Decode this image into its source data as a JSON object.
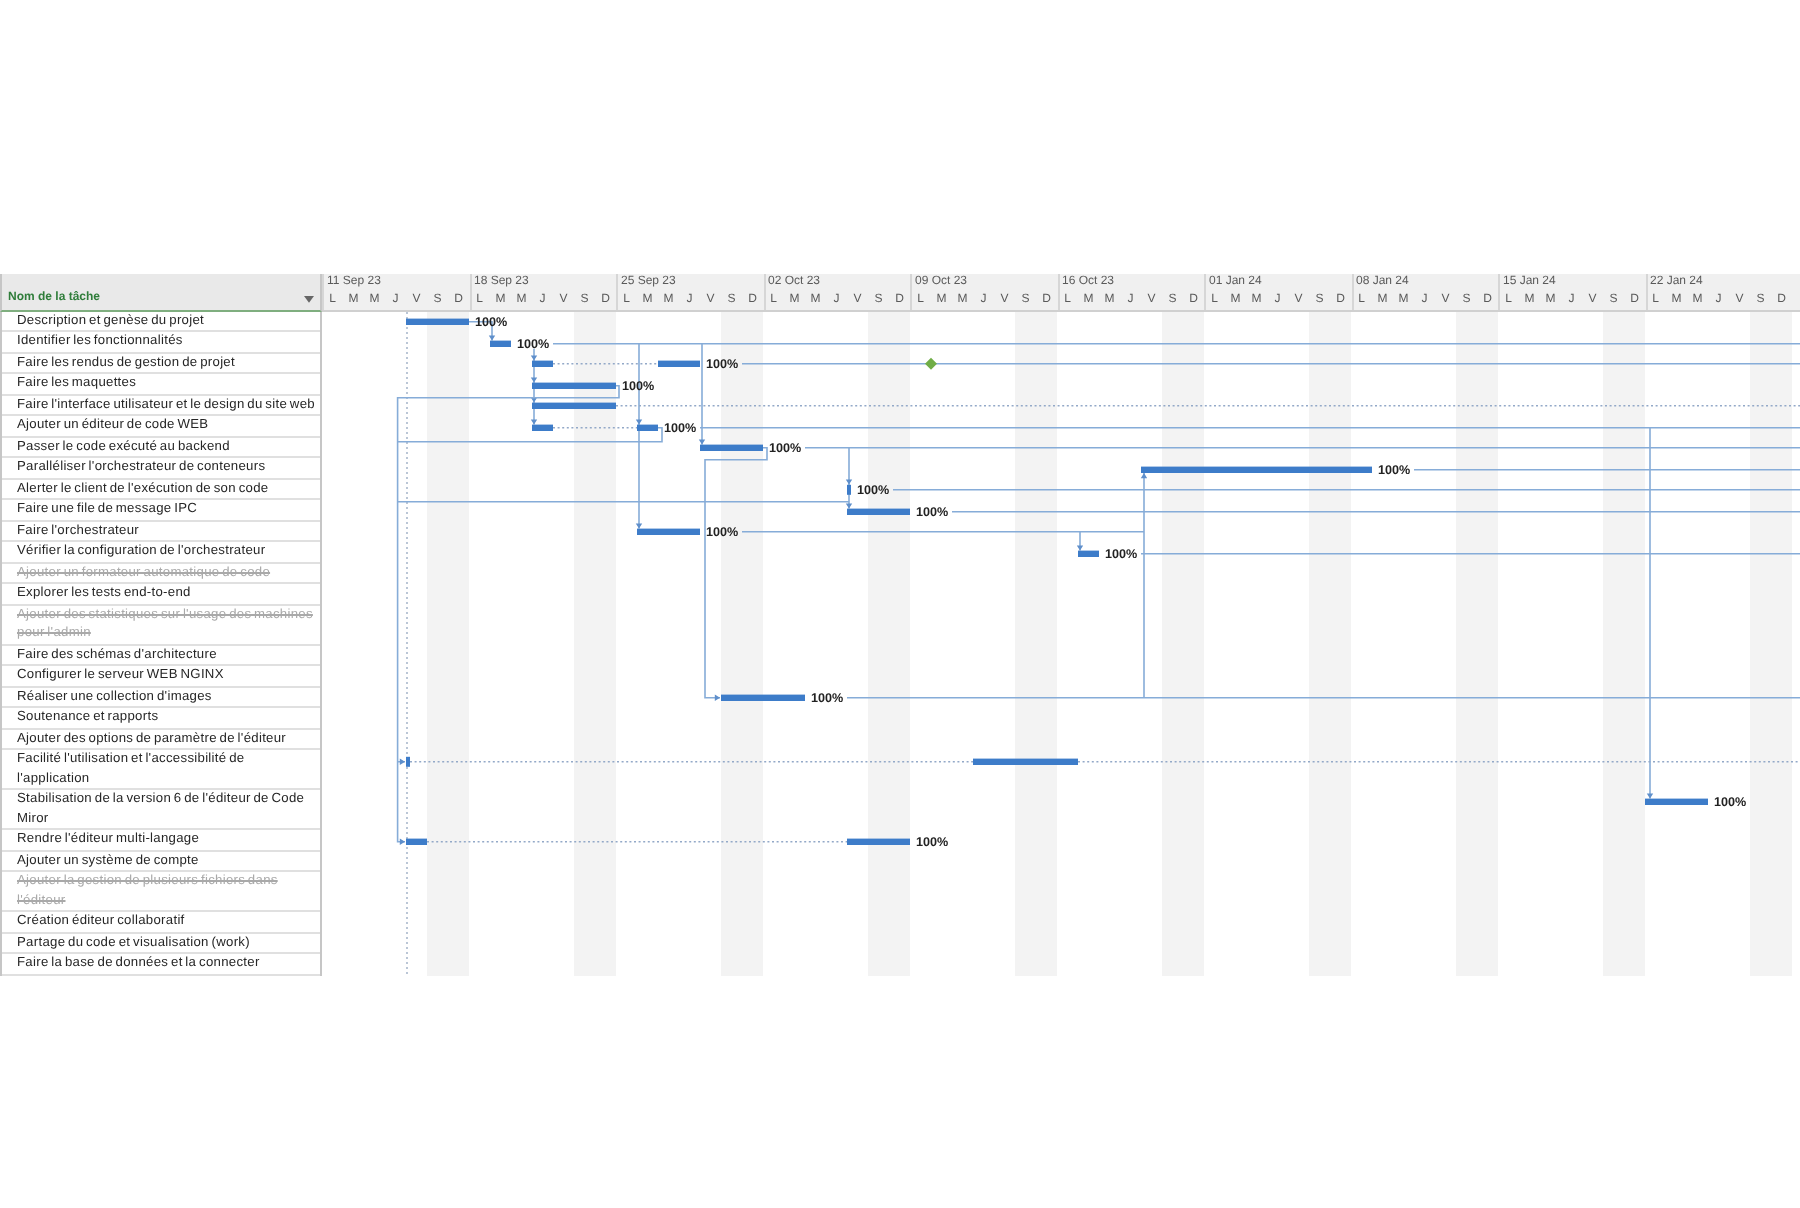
{
  "sheet": {
    "column_header": "Nom de la tâche"
  },
  "timeline": {
    "weeks": [
      {
        "label": "11 Sep 23",
        "days": [
          "L",
          "M",
          "M",
          "J",
          "V",
          "S",
          "D"
        ]
      },
      {
        "label": "18 Sep 23",
        "days": [
          "L",
          "M",
          "M",
          "J",
          "V",
          "S",
          "D"
        ]
      },
      {
        "label": "25 Sep 23",
        "days": [
          "L",
          "M",
          "M",
          "J",
          "V",
          "S",
          "D"
        ]
      },
      {
        "label": "02 Oct 23",
        "days": [
          "L",
          "M",
          "M",
          "J",
          "V",
          "S",
          "D"
        ]
      },
      {
        "label": "09 Oct 23",
        "days": [
          "L",
          "M",
          "M",
          "J",
          "V",
          "S",
          "D"
        ]
      },
      {
        "label": "16 Oct 23",
        "days": [
          "L",
          "M",
          "M",
          "J",
          "V",
          "S",
          "D"
        ]
      },
      {
        "label": "01 Jan 24",
        "days": [
          "L",
          "M",
          "M",
          "J",
          "V",
          "S",
          "D"
        ]
      },
      {
        "label": "08 Jan 24",
        "days": [
          "L",
          "M",
          "M",
          "J",
          "V",
          "S",
          "D"
        ]
      },
      {
        "label": "15 Jan 24",
        "days": [
          "L",
          "M",
          "M",
          "J",
          "V",
          "S",
          "D"
        ]
      },
      {
        "label": "22 Jan 24",
        "days": [
          "L",
          "M",
          "M",
          "J",
          "V",
          "S",
          "D"
        ]
      }
    ]
  },
  "tasks": [
    {
      "name": "Description et genèse du projet",
      "inactive": false,
      "progress": "100%"
    },
    {
      "name": "Identifier les fonctionnalités",
      "inactive": false,
      "progress": "100%"
    },
    {
      "name": "Faire les rendus de gestion de projet",
      "inactive": false,
      "progress": "100%"
    },
    {
      "name": "Faire les maquettes",
      "inactive": false,
      "progress": "100%"
    },
    {
      "name": "Faire l'interface utilisateur et le design du site web",
      "inactive": false
    },
    {
      "name": "Ajouter un éditeur de code WEB",
      "inactive": false,
      "progress": "100%"
    },
    {
      "name": "Passer le code exécuté au backend",
      "inactive": false,
      "progress": "100%"
    },
    {
      "name": "Paralléliser l'orchestrateur de conteneurs",
      "inactive": false,
      "progress": "100%"
    },
    {
      "name": "Alerter le client de l'exécution de son code",
      "inactive": false,
      "progress": "100%"
    },
    {
      "name": "Faire une file de message IPC",
      "inactive": false,
      "progress": "100%"
    },
    {
      "name": "Faire l'orchestrateur",
      "inactive": false,
      "progress": "100%"
    },
    {
      "name": "Vérifier la configuration de l'orchestrateur",
      "inactive": false,
      "progress": "100%"
    },
    {
      "name": "Ajouter un formateur automatique de code",
      "inactive": true
    },
    {
      "name": "Explorer les tests end-to-end",
      "inactive": false
    },
    {
      "name": "Ajouter des statistiques sur l'usage des machines pour l'admin",
      "inactive": true
    },
    {
      "name": "Faire des schémas d'architecture",
      "inactive": false
    },
    {
      "name": "Configurer le serveur WEB NGINX",
      "inactive": false
    },
    {
      "name": "Réaliser une collection d'images",
      "inactive": false,
      "progress": "100%"
    },
    {
      "name": "Soutenance et rapports",
      "inactive": false
    },
    {
      "name": "Ajouter des options de paramètre de l'éditeur",
      "inactive": false
    },
    {
      "name": "Facilité l'utilisation et l'accessibilité de l'application",
      "inactive": false
    },
    {
      "name": "Stabilisation de la version 6 de l'éditeur de Code Miror",
      "inactive": false,
      "progress": "100%"
    },
    {
      "name": "Rendre l'éditeur multi-langage",
      "inactive": false,
      "progress": "100%"
    },
    {
      "name": "Ajouter un système de compte",
      "inactive": false
    },
    {
      "name": "Ajouter la gestion de plusieurs fichiers dans l'éditeur",
      "inactive": true
    },
    {
      "name": "Création éditeur collaboratif",
      "inactive": false
    },
    {
      "name": "Partage du code et visualisation (work)",
      "inactive": false
    },
    {
      "name": "Faire la base de données et la connecter",
      "inactive": false
    }
  ]
}
